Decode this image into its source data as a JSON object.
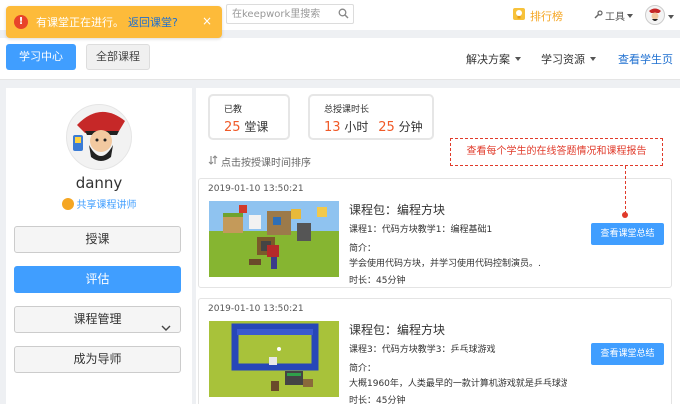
{
  "toast": {
    "message": "有课堂正在进行。",
    "link": "返回课堂?",
    "close": "×"
  },
  "topbar": {
    "search_placeholder": "在keepwork里搜索",
    "rank_label": "排行榜",
    "tools_label": "工具"
  },
  "nav": {
    "learning_center": "学习中心",
    "all_courses": "全部课程",
    "solutions": "解决方案",
    "resources": "学习资源",
    "student_page": "查看学生页"
  },
  "profile": {
    "username": "danny",
    "role": "共享课程讲师",
    "buttons": {
      "teach": "授课",
      "evaluate": "评估",
      "manage": "课程管理",
      "mentor": "成为导师"
    }
  },
  "stats": {
    "taught_label": "已教",
    "taught_value": "25",
    "taught_unit": "堂课",
    "duration_label": "总授课时长",
    "hours_value": "13",
    "hours_unit": "小时",
    "minutes_value": "25",
    "minutes_unit": "分钟"
  },
  "sort_label": "点击按授课时间排序",
  "hint": "查看每个学生的在线答题情况和课程报告",
  "intro_label": "简介：",
  "summary_button": "查看课堂总结",
  "sessions": [
    {
      "date": "2019-01-10   13:50:21",
      "package": "课程包：编程方块",
      "lesson": "课程1：代码方块教学1：编程基础1",
      "description": "学会使用代码方块，并学习使用代码控制演员。.",
      "duration": "时长：45分钟"
    },
    {
      "date": "2019-01-10   13:50:21",
      "package": "课程包：编程方块",
      "lesson": "课程3：代码方块教学3：乒乓球游戏",
      "description": "大概1960年，人类最早的一款计算机游戏就是乒乓球游戏...",
      "duration": "时长：45分钟"
    }
  ],
  "colors": {
    "primary": "#409eff",
    "accent": "#f05a28",
    "toast": "#fdbb3a",
    "hint": "#e03a2a"
  }
}
